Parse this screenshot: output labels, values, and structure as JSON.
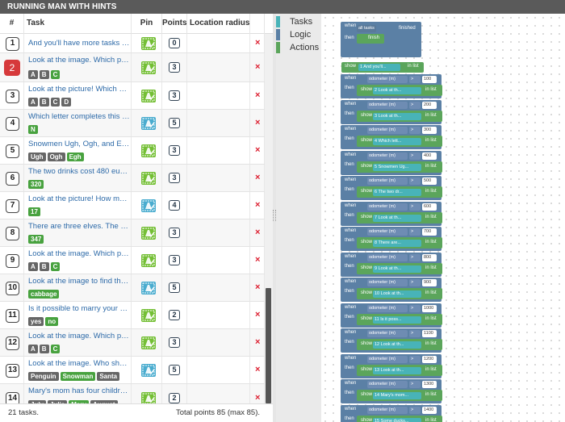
{
  "title": "RUNNING MAN WITH HINTS",
  "table": {
    "headers": {
      "num": "#",
      "task": "Task",
      "pin": "Pin",
      "points": "Points",
      "radius": "Location radius ..."
    },
    "rows": [
      {
        "num": "1",
        "task": "And you'll have more tasks app...",
        "options": [],
        "pin": "green",
        "points": "0",
        "highlight": false
      },
      {
        "num": "2",
        "task": "Look at the image. Which pictur...",
        "options": [
          {
            "t": "A",
            "ok": false
          },
          {
            "t": "B",
            "ok": false
          },
          {
            "t": "C",
            "ok": true
          }
        ],
        "pin": "green",
        "points": "3",
        "highlight": true
      },
      {
        "num": "3",
        "task": "Look at the picture! Which optio...",
        "options": [
          {
            "t": "A",
            "ok": false
          },
          {
            "t": "B",
            "ok": false
          },
          {
            "t": "C",
            "ok": false
          },
          {
            "t": "D",
            "ok": false
          }
        ],
        "pin": "green",
        "points": "3",
        "highlight": false
      },
      {
        "num": "4",
        "task": "Which letter completes this seq...",
        "options": [
          {
            "t": "N",
            "ok": true
          }
        ],
        "pin": "blue",
        "points": "5",
        "highlight": false
      },
      {
        "num": "5",
        "task": "Snowmen Ugh, Ogh, and Egh co...",
        "options": [
          {
            "t": "Ugh",
            "ok": false
          },
          {
            "t": "Ogh",
            "ok": false
          },
          {
            "t": "Egh",
            "ok": true
          }
        ],
        "pin": "green",
        "points": "3",
        "highlight": false
      },
      {
        "num": "6",
        "task": "The two drinks cost 480 euros. ...",
        "options": [
          {
            "t": "320",
            "ok": true
          }
        ],
        "pin": "green",
        "points": "3",
        "highlight": false
      },
      {
        "num": "7",
        "task": "Look at the picture! How many ...",
        "options": [
          {
            "t": "17",
            "ok": true
          }
        ],
        "pin": "blue",
        "points": "4",
        "highlight": false
      },
      {
        "num": "8",
        "task": "There are three elves. The oldes...",
        "options": [
          {
            "t": "347",
            "ok": true
          }
        ],
        "pin": "green",
        "points": "3",
        "highlight": false
      },
      {
        "num": "9",
        "task": "Look at the image. Which pictur...",
        "options": [
          {
            "t": "A",
            "ok": false
          },
          {
            "t": "B",
            "ok": false
          },
          {
            "t": "C",
            "ok": true
          }
        ],
        "pin": "green",
        "points": "3",
        "highlight": false
      },
      {
        "num": "10",
        "task": "Look at the image to find the ke...",
        "options": [
          {
            "t": "cabbage",
            "ok": true
          }
        ],
        "pin": "blue",
        "points": "5",
        "highlight": false
      },
      {
        "num": "11",
        "task": "Is it possible to marry your wid...",
        "options": [
          {
            "t": "yes",
            "ok": false
          },
          {
            "t": "no",
            "ok": true
          }
        ],
        "pin": "green",
        "points": "2",
        "highlight": false
      },
      {
        "num": "12",
        "task": "Look at the image. Which pictur...",
        "options": [
          {
            "t": "A",
            "ok": false
          },
          {
            "t": "B",
            "ok": false
          },
          {
            "t": "C",
            "ok": true
          }
        ],
        "pin": "green",
        "points": "3",
        "highlight": false
      },
      {
        "num": "13",
        "task": "Look at the image. Who should ...",
        "options": [
          {
            "t": "Penguin",
            "ok": false
          },
          {
            "t": "Snowman",
            "ok": true
          },
          {
            "t": "Santa",
            "ok": false
          }
        ],
        "pin": "blue",
        "points": "5",
        "highlight": false
      },
      {
        "num": "14",
        "task": "Mary's mom has four children. ...",
        "options": [
          {
            "t": "July",
            "ok": false
          },
          {
            "t": "Julie",
            "ok": false
          },
          {
            "t": "Mary",
            "ok": true
          },
          {
            "t": "August",
            "ok": false
          }
        ],
        "pin": "green",
        "points": "2",
        "highlight": false
      }
    ]
  },
  "footer": {
    "count": "21 tasks.",
    "total": "Total points 85 (max 85)."
  },
  "toolbox": [
    {
      "label": "Tasks",
      "color": "#48b3b8"
    },
    {
      "label": "Logic",
      "color": "#5b80a5"
    },
    {
      "label": "Actions",
      "color": "#5ba55b"
    }
  ],
  "blocks": {
    "when": "when",
    "then": "then",
    "show": "show",
    "in_list": "in list",
    "all_tasks": "all tasks",
    "finished": "finished",
    "finish": "finish",
    "odometer": "odometer (m)",
    "op": ">",
    "first_show_task": "1 And you'll...",
    "rules": [
      {
        "value": "100",
        "task": "2 Look at th..."
      },
      {
        "value": "200",
        "task": "3 Look at th..."
      },
      {
        "value": "300",
        "task": "4 Which lett..."
      },
      {
        "value": "400",
        "task": "5 Snowmen Ug..."
      },
      {
        "value": "500",
        "task": "6 The two dr..."
      },
      {
        "value": "600",
        "task": "7 Look at th..."
      },
      {
        "value": "700",
        "task": "8 There are..."
      },
      {
        "value": "800",
        "task": "9 Look at th..."
      },
      {
        "value": "900",
        "task": "10 Look at th..."
      },
      {
        "value": "1000",
        "task": "11 Is it poss..."
      },
      {
        "value": "1100",
        "task": "12 Look at th..."
      },
      {
        "value": "1200",
        "task": "13 Look at th..."
      },
      {
        "value": "1300",
        "task": "14 Mary's mom..."
      },
      {
        "value": "1400",
        "task": "15 Some ducks..."
      }
    ]
  }
}
